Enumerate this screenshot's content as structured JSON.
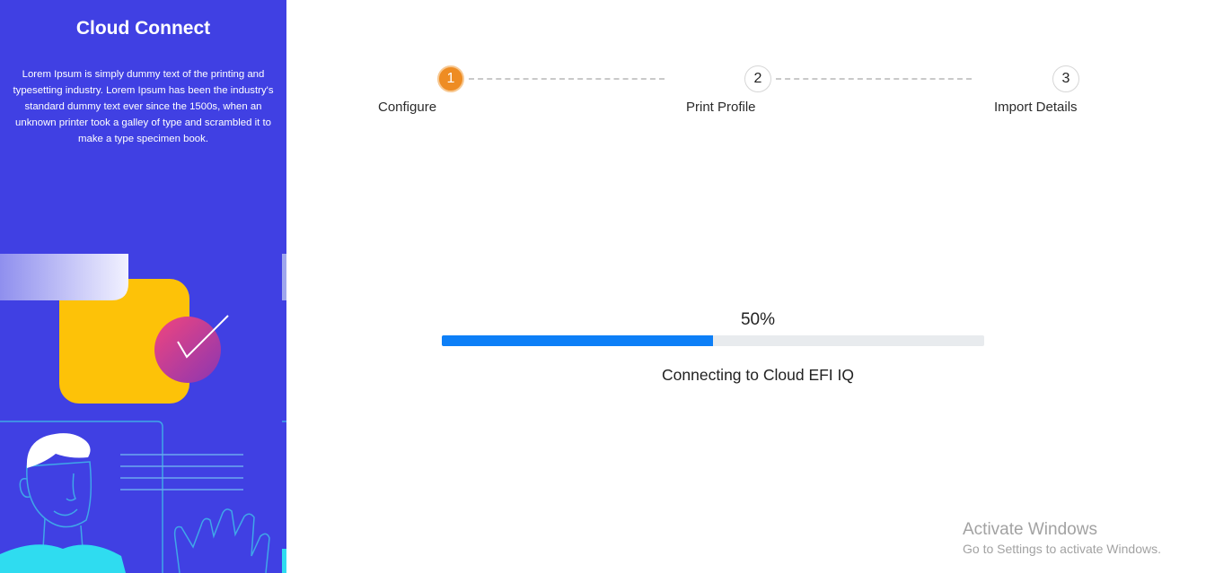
{
  "sidebar": {
    "title": "Cloud Connect",
    "description": "Lorem Ipsum is simply dummy text of the printing and typesetting industry. Lorem Ipsum has been the industry's standard dummy text ever since the 1500s, when an unknown printer took a galley of type and scrambled it to make a type specimen book.",
    "background_color": "#4040e3"
  },
  "stepper": {
    "active_step": 1,
    "steps": [
      {
        "number": "1",
        "label": "Configure",
        "state": "active"
      },
      {
        "number": "2",
        "label": "Print Profile",
        "state": "pending"
      },
      {
        "number": "3",
        "label": "Import Details",
        "state": "pending"
      }
    ],
    "active_color": "#ee8c23"
  },
  "progress": {
    "value": 50,
    "percent_label": "50%",
    "status_text": "Connecting to Cloud EFI IQ",
    "fill_color": "#0d7ff7"
  },
  "watermark": {
    "title": "Activate Windows",
    "subtitle": "Go to Settings to activate Windows."
  }
}
